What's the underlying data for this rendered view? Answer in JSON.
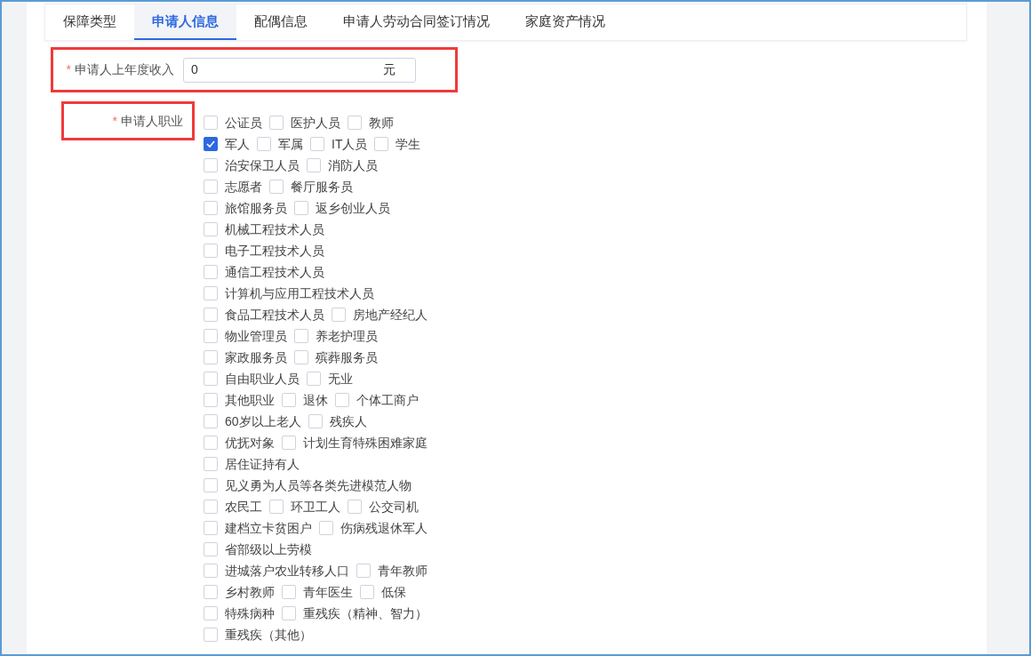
{
  "tabs": [
    {
      "label": "保障类型",
      "selected": false
    },
    {
      "label": "申请人信息",
      "selected": true
    },
    {
      "label": "配偶信息",
      "selected": false
    },
    {
      "label": "申请人劳动合同签订情况",
      "selected": false
    },
    {
      "label": "家庭资产情况",
      "selected": false
    }
  ],
  "income": {
    "required": "*",
    "label": "申请人上年度收入",
    "value": "0",
    "unit": "元",
    "highlighted": true
  },
  "occupation": {
    "required": "*",
    "label": "申请人职业",
    "highlighted": true,
    "rows": [
      [
        {
          "label": "公证员",
          "checked": false
        },
        {
          "label": "医护人员",
          "checked": false
        },
        {
          "label": "教师",
          "checked": false
        }
      ],
      [
        {
          "label": "军人",
          "checked": true
        },
        {
          "label": "军属",
          "checked": false
        },
        {
          "label": "IT人员",
          "checked": false
        },
        {
          "label": "学生",
          "checked": false
        }
      ],
      [
        {
          "label": "治安保卫人员",
          "checked": false
        },
        {
          "label": "消防人员",
          "checked": false
        }
      ],
      [
        {
          "label": "志愿者",
          "checked": false
        },
        {
          "label": "餐厅服务员",
          "checked": false
        }
      ],
      [
        {
          "label": "旅馆服务员",
          "checked": false
        },
        {
          "label": "返乡创业人员",
          "checked": false
        }
      ],
      [
        {
          "label": "机械工程技术人员",
          "checked": false
        }
      ],
      [
        {
          "label": "电子工程技术人员",
          "checked": false
        }
      ],
      [
        {
          "label": "通信工程技术人员",
          "checked": false
        }
      ],
      [
        {
          "label": "计算机与应用工程技术人员",
          "checked": false
        }
      ],
      [
        {
          "label": "食品工程技术人员",
          "checked": false
        },
        {
          "label": "房地产经纪人",
          "checked": false
        }
      ],
      [
        {
          "label": "物业管理员",
          "checked": false
        },
        {
          "label": "养老护理员",
          "checked": false
        }
      ],
      [
        {
          "label": "家政服务员",
          "checked": false
        },
        {
          "label": "殡葬服务员",
          "checked": false
        }
      ],
      [
        {
          "label": "自由职业人员",
          "checked": false
        },
        {
          "label": "无业",
          "checked": false
        }
      ],
      [
        {
          "label": "其他职业",
          "checked": false
        },
        {
          "label": "退休",
          "checked": false
        },
        {
          "label": "个体工商户",
          "checked": false
        }
      ],
      [
        {
          "label": "60岁以上老人",
          "checked": false
        },
        {
          "label": "残疾人",
          "checked": false
        }
      ],
      [
        {
          "label": "优抚对象",
          "checked": false
        },
        {
          "label": "计划生育特殊困难家庭",
          "checked": false
        }
      ],
      [
        {
          "label": "居住证持有人",
          "checked": false
        }
      ],
      [
        {
          "label": "见义勇为人员等各类先进模范人物",
          "checked": false
        }
      ],
      [
        {
          "label": "农民工",
          "checked": false
        },
        {
          "label": "环卫工人",
          "checked": false
        },
        {
          "label": "公交司机",
          "checked": false
        }
      ],
      [
        {
          "label": "建档立卡贫困户",
          "checked": false
        },
        {
          "label": "伤病残退休军人",
          "checked": false
        }
      ],
      [
        {
          "label": "省部级以上劳模",
          "checked": false
        }
      ],
      [
        {
          "label": "进城落户农业转移人口",
          "checked": false
        },
        {
          "label": "青年教师",
          "checked": false
        }
      ],
      [
        {
          "label": "乡村教师",
          "checked": false
        },
        {
          "label": "青年医生",
          "checked": false
        },
        {
          "label": "低保",
          "checked": false
        }
      ],
      [
        {
          "label": "特殊病种",
          "checked": false
        },
        {
          "label": "重残疾（精神、智力）",
          "checked": false
        }
      ],
      [
        {
          "label": "重残疾（其他）",
          "checked": false
        }
      ]
    ]
  }
}
